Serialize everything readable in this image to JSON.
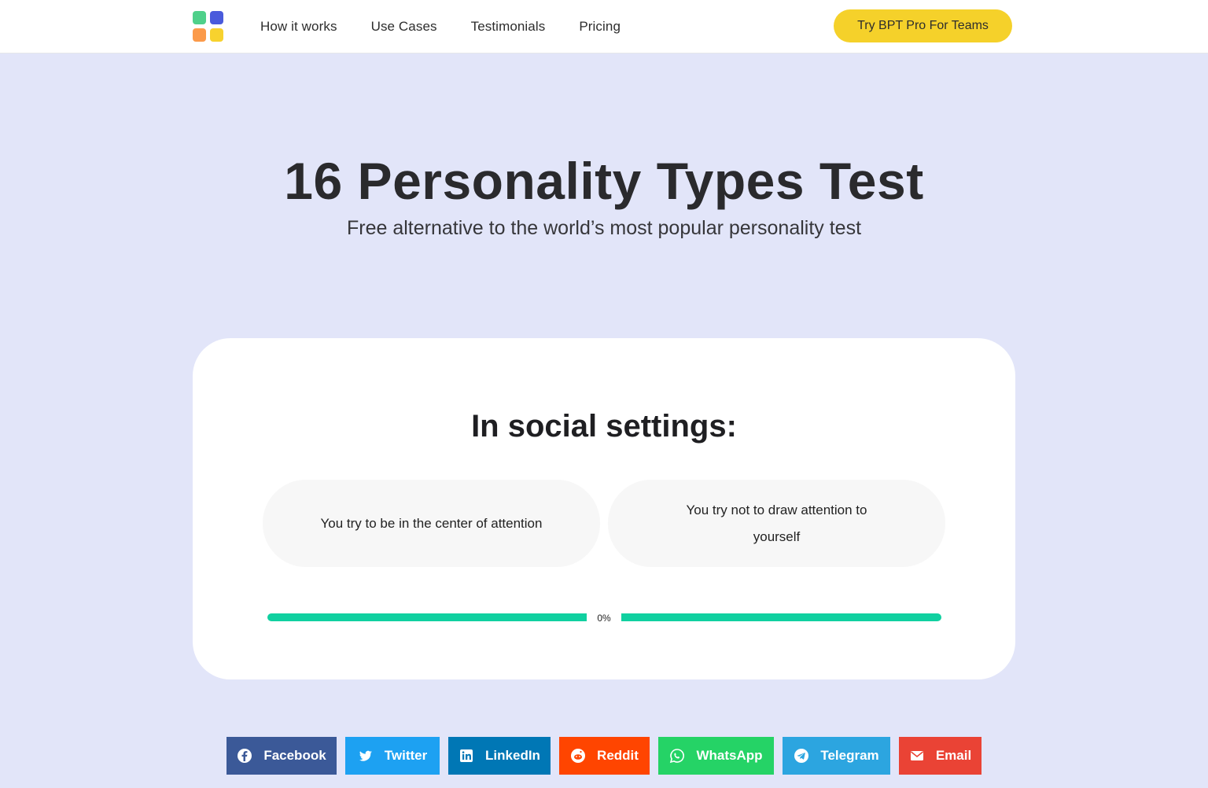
{
  "header": {
    "logo_icon": "four-squares-logo-icon",
    "nav": [
      {
        "label": "How it works"
      },
      {
        "label": "Use Cases"
      },
      {
        "label": "Testimonials"
      },
      {
        "label": "Pricing"
      }
    ],
    "cta_label": "Try BPT Pro For Teams"
  },
  "hero": {
    "title": "16 Personality Types Test",
    "subtitle": "Free alternative to the world’s most popular personality test"
  },
  "quiz": {
    "question": "In social settings:",
    "options": [
      {
        "label": "You try to be in the center of attention"
      },
      {
        "label": "You try not to draw attention to yourself"
      }
    ],
    "progress_label": "0%",
    "progress_value": 0
  },
  "share": [
    {
      "label": "Facebook",
      "icon": "facebook-icon",
      "color": "#3b5998"
    },
    {
      "label": "Twitter",
      "icon": "twitter-icon",
      "color": "#1da1f2"
    },
    {
      "label": "LinkedIn",
      "icon": "linkedin-icon",
      "color": "#0077b5"
    },
    {
      "label": "Reddit",
      "icon": "reddit-icon",
      "color": "#ff4500"
    },
    {
      "label": "WhatsApp",
      "icon": "whatsapp-icon",
      "color": "#25d366"
    },
    {
      "label": "Telegram",
      "icon": "telegram-icon",
      "color": "#2ca5e0"
    },
    {
      "label": "Email",
      "icon": "email-icon",
      "color": "#ea4335"
    }
  ],
  "colors": {
    "page_bg": "#e2e5f9",
    "cta": "#f5d12a",
    "progress": "#10d0a0"
  }
}
